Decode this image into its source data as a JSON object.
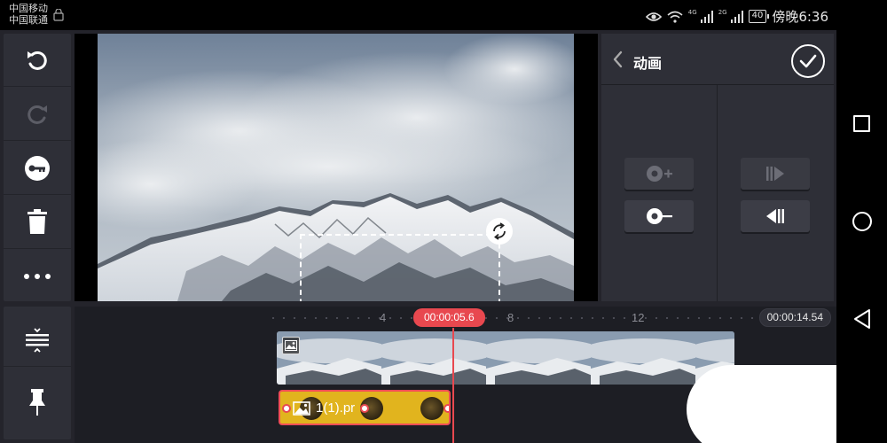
{
  "status_bar": {
    "carrier_1": "中国移动",
    "carrier_2": "中国联通",
    "signal_1_tag": "4G",
    "signal_2_tag": "2G",
    "battery": "40",
    "time": "傍晚6:36"
  },
  "left_toolbar": {
    "items": [
      "undo-icon",
      "redo-icon",
      "key-icon",
      "trash-icon",
      "more-icon"
    ],
    "bottom_items": [
      "align-icon",
      "pin-icon"
    ]
  },
  "panel": {
    "title": "动画",
    "buttons": [
      "add-keyframe-icon",
      "remove-keyframe-icon",
      "next-keyframe-icon",
      "prev-keyframe-icon"
    ]
  },
  "timeline": {
    "ruler": [
      "4",
      "8",
      "12"
    ],
    "playhead_time": "00:00:05.6",
    "total_time": "00:00:14.54",
    "overlay_clip_label": "1(1).pr"
  },
  "colors": {
    "accent_red": "#e8484f",
    "clip_yellow": "#e1b41e",
    "panel_bg": "#2e2f37",
    "app_bg": "#24242b"
  }
}
